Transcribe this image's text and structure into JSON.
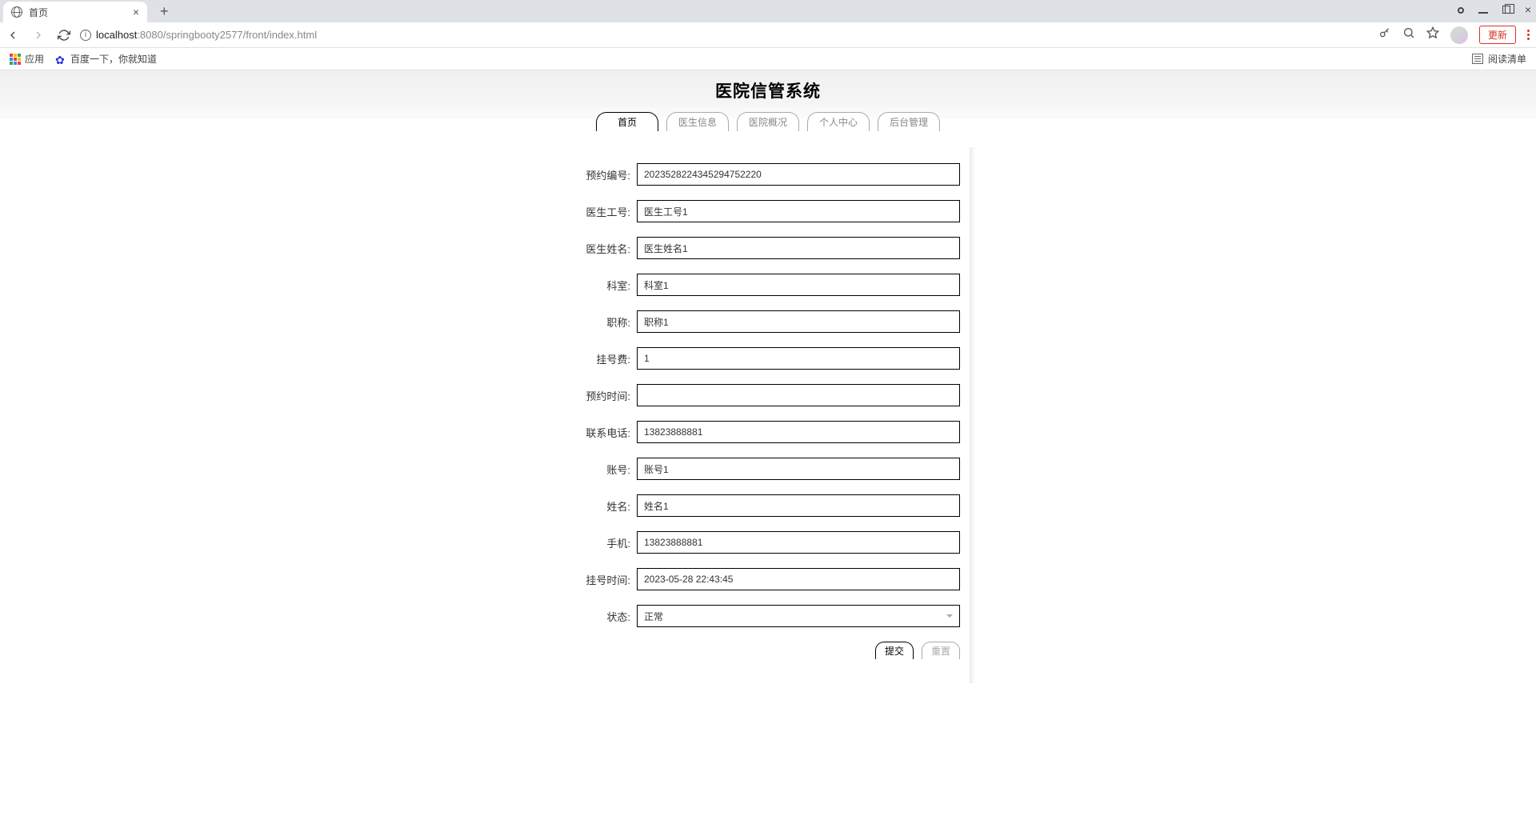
{
  "browser": {
    "tab_title": "首页",
    "url_host": "localhost",
    "url_port": ":8080",
    "url_path": "/springbooty2577/front/index.html",
    "update_btn": "更新"
  },
  "bookmarks": {
    "apps": "应用",
    "baidu": "百度一下，你就知道",
    "reading_list": "阅读清单"
  },
  "page": {
    "title": "医院信管系统",
    "tabs": [
      "首页",
      "医生信息",
      "医院概况",
      "个人中心",
      "后台管理"
    ]
  },
  "form": {
    "fields": [
      {
        "label": "预约编号",
        "value": "2023528224345294752220"
      },
      {
        "label": "医生工号",
        "value": "医生工号1"
      },
      {
        "label": "医生姓名",
        "value": "医生姓名1"
      },
      {
        "label": "科室",
        "value": "科室1"
      },
      {
        "label": "职称",
        "value": "职称1"
      },
      {
        "label": "挂号费",
        "value": "1"
      },
      {
        "label": "预约时间",
        "value": ""
      },
      {
        "label": "联系电话",
        "value": "13823888881"
      },
      {
        "label": "账号",
        "value": "账号1"
      },
      {
        "label": "姓名",
        "value": "姓名1"
      },
      {
        "label": "手机",
        "value": "13823888881"
      },
      {
        "label": "挂号时间",
        "value": "2023-05-28 22:43:45"
      }
    ],
    "status_label": "状态",
    "status_value": "正常",
    "submit": "提交",
    "reset": "重置"
  }
}
